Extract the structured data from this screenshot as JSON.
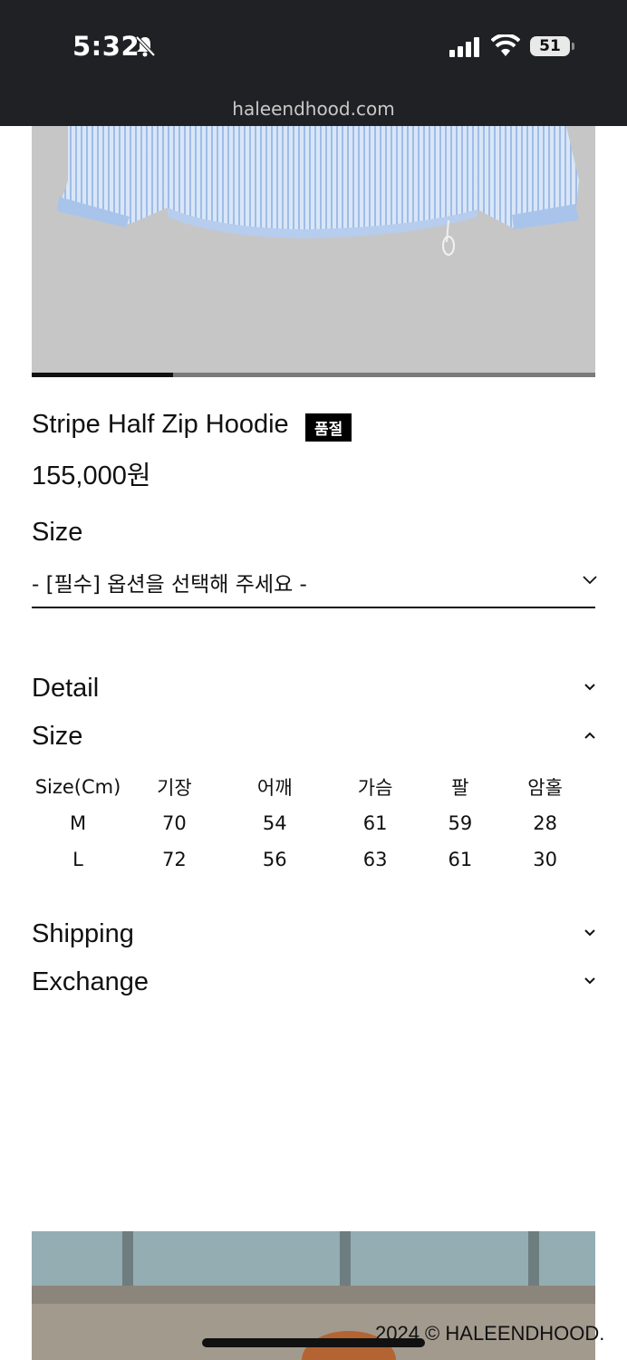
{
  "status_bar": {
    "time": "5:32",
    "battery": "51",
    "url": "haleendhood.com"
  },
  "product": {
    "title": "Stripe Half Zip Hoodie",
    "badge": "품절",
    "price": "155,000원",
    "image_slider_progress": 0.25
  },
  "option": {
    "label": "Size",
    "selected_value": "- [필수] 옵션을 선택해 주세요 -"
  },
  "accordion": {
    "detail_label": "Detail",
    "size_label": "Size",
    "shipping_label": "Shipping",
    "exchange_label": "Exchange"
  },
  "size_table": {
    "headers": [
      "Size(Cm)",
      "기장",
      "어깨",
      "가슴",
      "팔",
      "암홀"
    ],
    "rows": [
      [
        "M",
        "70",
        "54",
        "61",
        "59",
        "28"
      ],
      [
        "L",
        "72",
        "56",
        "63",
        "61",
        "30"
      ]
    ]
  },
  "footer": {
    "copyright": "2024 © HALEENDHOOD."
  },
  "colors": {
    "status_bar_bg": "#202124",
    "image_bg": "#c6c6c6",
    "badge_bg": "#000000"
  }
}
